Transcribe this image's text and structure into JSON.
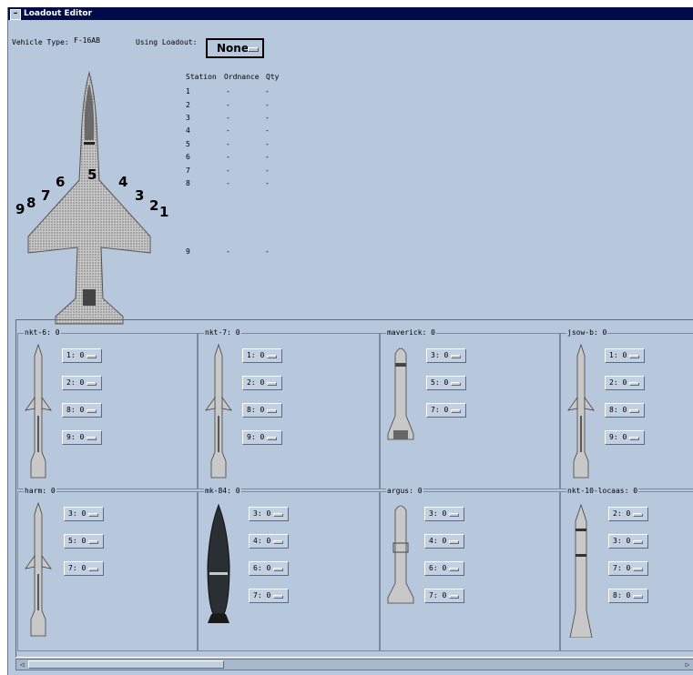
{
  "window": {
    "title": "Loadout Editor"
  },
  "header": {
    "vehicle_type_label": "Vehicle Type:",
    "vehicle_type_value": "F-16AB",
    "using_loadout_label": "Using Loadout:",
    "loadout_value": "None"
  },
  "station_table": {
    "headers": [
      "Station",
      "Ordnance",
      "Qty"
    ],
    "rows": [
      {
        "station": "1",
        "ordnance": "-",
        "qty": "-"
      },
      {
        "station": "2",
        "ordnance": "-",
        "qty": "-"
      },
      {
        "station": "3",
        "ordnance": "-",
        "qty": "-"
      },
      {
        "station": "4",
        "ordnance": "-",
        "qty": "-"
      },
      {
        "station": "5",
        "ordnance": "-",
        "qty": "-"
      },
      {
        "station": "6",
        "ordnance": "-",
        "qty": "-"
      },
      {
        "station": "7",
        "ordnance": "-",
        "qty": "-"
      },
      {
        "station": "8",
        "ordnance": "-",
        "qty": "-"
      },
      {
        "station": "9",
        "ordnance": "-",
        "qty": "-"
      }
    ]
  },
  "aircraft_stations": [
    "9",
    "8",
    "7",
    "6",
    "5",
    "4",
    "3",
    "2",
    "1"
  ],
  "weapons": [
    {
      "title": "nkt-6: 0",
      "buttons": [
        "1: 0",
        "2: 0",
        "8: 0",
        "9: 0"
      ]
    },
    {
      "title": "nkt-7: 0",
      "buttons": [
        "1: 0",
        "2: 0",
        "8: 0",
        "9: 0"
      ]
    },
    {
      "title": "maverick: 0",
      "buttons": [
        "3: 0",
        "5: 0",
        "7: 0"
      ]
    },
    {
      "title": "jsow-b: 0",
      "buttons": [
        "1: 0",
        "2: 0",
        "8: 0",
        "9: 0"
      ]
    },
    {
      "title": "harm: 0",
      "buttons": [
        "3: 0",
        "5: 0",
        "7: 0"
      ]
    },
    {
      "title": "mk-84: 0",
      "buttons": [
        "3: 0",
        "4: 0",
        "6: 0",
        "7: 0"
      ]
    },
    {
      "title": "argus: 0",
      "buttons": [
        "3: 0",
        "4: 0",
        "6: 0",
        "7: 0"
      ]
    },
    {
      "title": "nkt-10-locaas: 0",
      "buttons": [
        "2: 0",
        "3: 0",
        "7: 0",
        "8: 0"
      ]
    }
  ],
  "colors": {
    "window_bg": "#b8c8dc",
    "titlebar_bg": "#000c4a",
    "button_bg": "#c2d0e2"
  },
  "icons": [
    "window-menu-icon",
    "option-menu-indicator-icon",
    "f16-aircraft-icon",
    "missile-icon",
    "bomb-icon",
    "scroll-left-icon",
    "scroll-right-icon"
  ]
}
